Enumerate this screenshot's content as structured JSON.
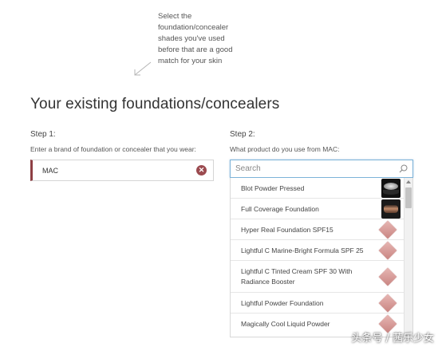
{
  "hint": "Select the foundation/concealer shades you've used before that are a good match for your skin",
  "section_title": "Your existing foundations/concealers",
  "step1": {
    "label": "Step 1:",
    "description": "Enter a brand of foundation or concealer that you wear:",
    "brand_value": "MAC",
    "clear_icon": "close-circle-icon"
  },
  "step2": {
    "label": "Step 2:",
    "description": "What product do you use from MAC:",
    "search_placeholder": "Search",
    "search_icon": "search-icon",
    "products": [
      {
        "name": "Blot Powder Pressed",
        "thumb": "compact-powder-icon"
      },
      {
        "name": "Full Coverage Foundation",
        "thumb": "tube-foundation-icon"
      },
      {
        "name": "Hyper Real Foundation SPF15",
        "thumb": "swatch-icon"
      },
      {
        "name": "Lightful C Marine-Bright Formula SPF 25",
        "thumb": "swatch-icon"
      },
      {
        "name": "Lightful C Tinted Cream SPF 30 With Radiance Booster",
        "thumb": "swatch-icon"
      },
      {
        "name": "Lightful Powder Foundation",
        "thumb": "swatch-icon"
      },
      {
        "name": "Magically Cool Liquid Powder",
        "thumb": "swatch-icon"
      }
    ]
  },
  "watermark": "头条号 / 茜乐少女",
  "colors": {
    "accent": "#8e3f44",
    "search_border": "#7db3d8",
    "swatch": "#d9a09d"
  }
}
